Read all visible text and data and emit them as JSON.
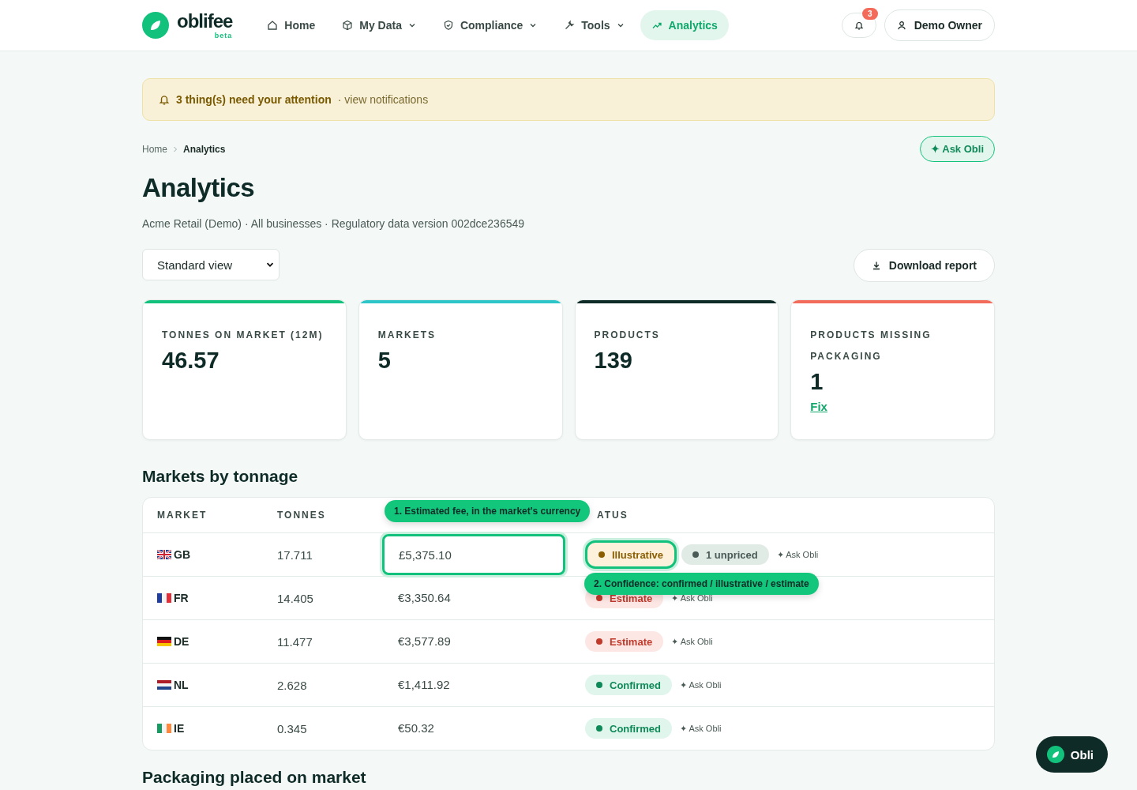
{
  "nav": {
    "logo": "oblifee",
    "logo_tag": "beta",
    "items": [
      {
        "label": "Home",
        "dropdown": false,
        "selected": false
      },
      {
        "label": "My Data",
        "dropdown": true,
        "selected": false
      },
      {
        "label": "Compliance",
        "dropdown": true,
        "selected": false
      },
      {
        "label": "Tools",
        "dropdown": true,
        "selected": false
      },
      {
        "label": "Analytics",
        "dropdown": false,
        "selected": true
      }
    ],
    "notification_count": "3",
    "user": "Demo Owner"
  },
  "alert": {
    "strong": "3 thing(s) need your attention",
    "link": "· view notifications"
  },
  "breadcrumb": [
    "Home",
    "Analytics"
  ],
  "ask_button": {
    "icon": "✦",
    "label": "Ask Obli"
  },
  "title": "Analytics",
  "subtitle": "Acme Retail (Demo) · All businesses · Regulatory data version 002dce236549",
  "view_select": "Standard view",
  "download": "Download report",
  "cards": [
    {
      "label": "TONNES ON MARKET (12M)",
      "value": "46.57",
      "color": "#12c27c"
    },
    {
      "label": "MARKETS",
      "value": "5",
      "color": "#2ec5c8"
    },
    {
      "label": "PRODUCTS",
      "value": "139",
      "color": "#0e2b27"
    },
    {
      "label": "PRODUCTS MISSING PACKAGING",
      "value": "1",
      "color": "#f26b5b",
      "link": "Fix"
    }
  ],
  "markets": {
    "heading": "Markets by tonnage",
    "columns": [
      "MARKET",
      "TONNES",
      "ATUS"
    ],
    "rows": [
      {
        "kind": "gb",
        "market": "GB",
        "tonnes": "17.711",
        "fee": "£5,375.10",
        "fee_highlighted": true,
        "status": {
          "label": "Illustrative",
          "kind": "illustrative",
          "highlighted": true
        },
        "extra": "1 unpriced",
        "ask": {
          "icon": "✦",
          "label": "Ask Obli"
        }
      },
      {
        "kind": "fr",
        "market": "FR",
        "tonnes": "14.405",
        "fee": "€3,350.64",
        "fee_highlighted": false,
        "status": {
          "label": "Estimate",
          "kind": "estimate",
          "highlighted": false
        },
        "ask": {
          "icon": "✦",
          "label": "Ask Obli"
        }
      },
      {
        "kind": "de",
        "market": "DE",
        "tonnes": "11.477",
        "fee": "€3,577.89",
        "fee_highlighted": false,
        "status": {
          "label": "Estimate",
          "kind": "estimate",
          "highlighted": false
        },
        "ask": {
          "icon": "✦",
          "label": "Ask Obli"
        }
      },
      {
        "kind": "nl",
        "market": "NL",
        "tonnes": "2.628",
        "fee": "€1,411.92",
        "fee_highlighted": false,
        "status": {
          "label": "Confirmed",
          "kind": "confirmed",
          "highlighted": false
        },
        "ask": {
          "icon": "✦",
          "label": "Ask Obli"
        }
      },
      {
        "kind": "ie",
        "market": "IE",
        "tonnes": "0.345",
        "fee": "€50.32",
        "fee_highlighted": false,
        "status": {
          "label": "Confirmed",
          "kind": "confirmed",
          "highlighted": false
        },
        "ask": {
          "icon": "✦",
          "label": "Ask Obli"
        }
      }
    ],
    "tooltips": [
      "1. Estimated fee, in the market's currency",
      "2. Confidence: confirmed / illustrative / estimate"
    ]
  },
  "next_heading": "Packaging placed on market",
  "chat_button": "Obli"
}
